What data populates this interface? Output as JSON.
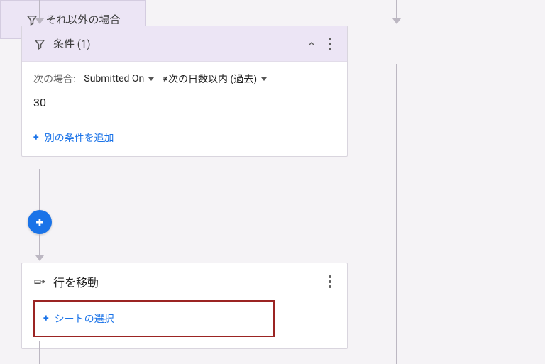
{
  "condition": {
    "header_label": "条件 (1)",
    "when_label": "次の場合:",
    "field": "Submitted On",
    "operator": "≠次の日数以内 (過去)",
    "value": "30",
    "add_another": "別の条件を追加"
  },
  "else_card": {
    "label": "それ以外の場合"
  },
  "move_row": {
    "title": "行を移動",
    "select_sheet": "シートの選択"
  },
  "icons": {
    "filter": "filter",
    "caret_up": "caret-up",
    "kebab": "more-vert",
    "move": "move-row",
    "plus": "+"
  }
}
